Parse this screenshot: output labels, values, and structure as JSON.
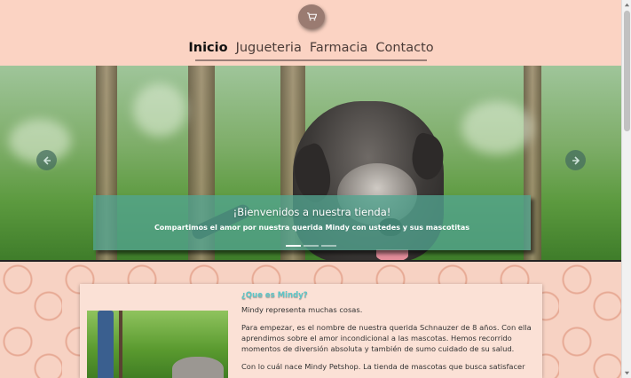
{
  "header": {
    "cart_icon": "shopping-cart-icon",
    "nav": [
      {
        "label": "Inicio",
        "active": true
      },
      {
        "label": "Jugueteria",
        "active": false
      },
      {
        "label": "Farmacia",
        "active": false
      },
      {
        "label": "Contacto",
        "active": false
      }
    ]
  },
  "carousel": {
    "title": "¡Bienvenidos a nuestra tienda!",
    "subtitle": "Compartimos el amor por nuestra querida Mindy con ustedes y sus mascotitas",
    "prev_icon": "arrow-left-icon",
    "next_icon": "arrow-right-icon",
    "slide_count": 3,
    "active_slide": 1
  },
  "about": {
    "heading": "¿Que es Mindy?",
    "paragraphs": [
      "Mindy representa muchas cosas.",
      "Para empezar, es el nombre de nuestra querida Schnauzer de 8 años. Con ella aprendimos sobre el amor incondicional a las mascotas. Hemos recorrido momentos de diversión absoluta y también de sumo cuidado de su salud.",
      "Con lo cuál nace Mindy Petshop. La tienda de mascotas que busca satisfacer"
    ]
  },
  "colors": {
    "background": "#f9cfbf",
    "caption_bg": "#52a48f",
    "heading_accent": "#5dc6c8"
  }
}
